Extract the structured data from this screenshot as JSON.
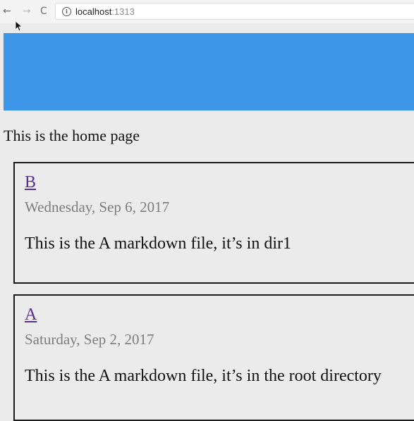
{
  "browser": {
    "back_icon": "←",
    "forward_icon": "→",
    "reload_icon": "C",
    "info_icon": "i",
    "url_host": "localhost",
    "url_port": ":1313"
  },
  "header": {
    "banner_color": "#3d96e8"
  },
  "page": {
    "intro": "This is the home page"
  },
  "posts": [
    {
      "title": "B",
      "date": "Wednesday, Sep 6, 2017",
      "summary": "This is the A markdown file, it’s in dir1"
    },
    {
      "title": "A",
      "date": "Saturday, Sep 2, 2017",
      "summary": "This is the A markdown file, it’s in the root directory"
    }
  ]
}
